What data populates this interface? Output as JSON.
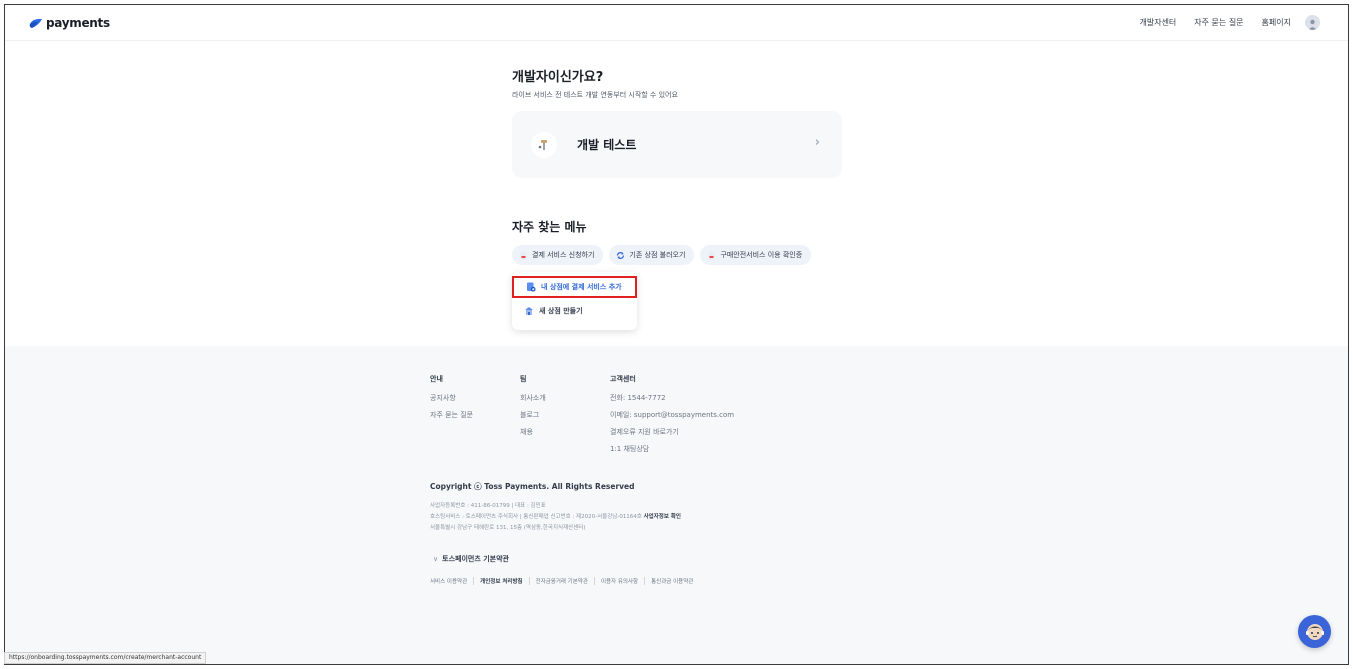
{
  "header": {
    "logo_text": "payments",
    "nav": [
      "개발자센터",
      "자주 묻는 질문",
      "홈페이지"
    ]
  },
  "dev": {
    "title": "개발자이신가요?",
    "subtitle": "라이브 서비스 전 테스트 개발 연동부터 시작할 수 있어요",
    "card_label": "개발 테스트"
  },
  "menu": {
    "title": "자주 찾는 메뉴",
    "chips": [
      "결제 서비스 신청하기",
      "기존 상점 불러오기",
      "구매안전서비스 이용 확인증"
    ],
    "dropdown": [
      "내 상점에 결제 서비스 추가",
      "새 상점 만들기"
    ]
  },
  "footer": {
    "info": {
      "title": "안내",
      "items": [
        "공지사항",
        "자주 묻는 질문"
      ]
    },
    "team": {
      "title": "팀",
      "items": [
        "회사소개",
        "블로그",
        "채용"
      ]
    },
    "support": {
      "title": "고객센터",
      "items": [
        "전화: 1544-7772",
        "이메일: support@tosspayments.com",
        "결제오류 지원 바로가기",
        "1:1 채팅상담"
      ]
    },
    "copyright": "Copyright ⓒ Toss Payments. All Rights Reserved",
    "biz_line1": "사업자등록번호 : 411-86-01799 | 대표 : 김민표",
    "biz_line2": "호스팅서비스 : 토스페이먼츠 주식회사 | 통신판매업 신고번호 : 제2020-서울강남-01164호",
    "biz_line2_link": "사업자정보 확인",
    "biz_line3": "서울특별시 강남구 테헤란로 131, 15층 (역삼동,한국지식재산센터)",
    "terms_title": "토스페이먼츠 기본약관",
    "terms": [
      "서비스 이용약관",
      "개인정보 처리방침",
      "전자금융거래 기본약관",
      "이용자 유의사항",
      "통신과금 이용약관"
    ]
  },
  "statusbar": "https://onboarding.tosspayments.com/create/merchant-account",
  "colors": {
    "accent": "#3168d8",
    "highlight": "#e01f1f",
    "footer_bg": "#f7f8fa",
    "chip_bg": "#eef2f9"
  }
}
